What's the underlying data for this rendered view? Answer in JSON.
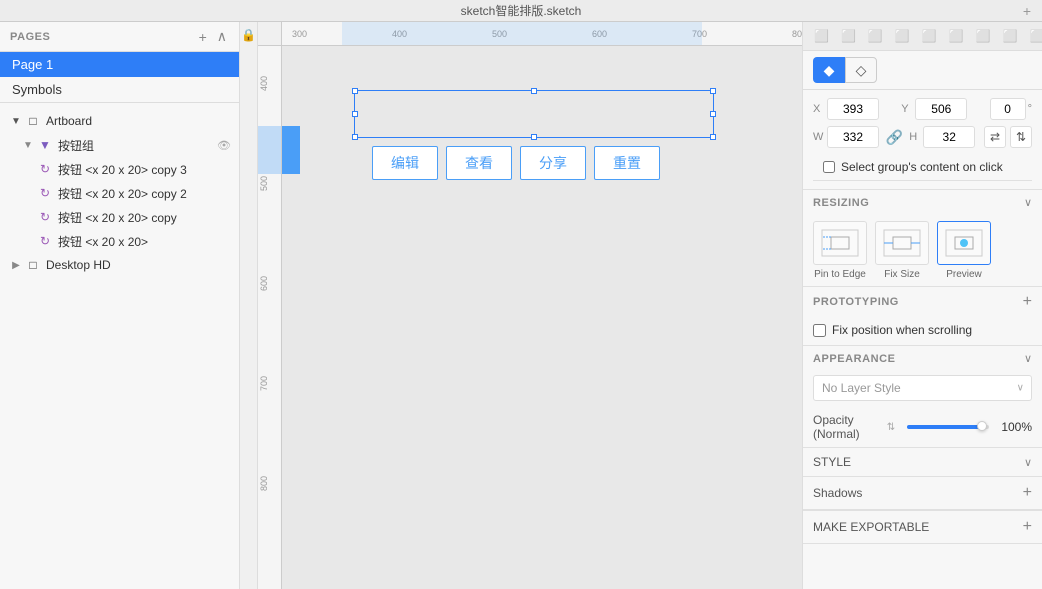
{
  "app": {
    "title": "sketch智能排版.sketch"
  },
  "left_panel": {
    "pages_title": "PAGES",
    "pages": [
      {
        "label": "Page 1",
        "active": true
      },
      {
        "label": "Symbols",
        "active": false
      }
    ],
    "layers": [
      {
        "id": "artboard",
        "label": "Artboard",
        "indent": 0,
        "type": "artboard",
        "expanded": true
      },
      {
        "id": "btn-group",
        "label": "按钮组",
        "indent": 1,
        "type": "folder",
        "expanded": true
      },
      {
        "id": "btn-copy3",
        "label": "按钮 <x 20 x 20>  copy 3",
        "indent": 2,
        "type": "component"
      },
      {
        "id": "btn-copy2",
        "label": "按钮 <x 20 x 20>  copy 2",
        "indent": 2,
        "type": "component"
      },
      {
        "id": "btn-copy",
        "label": "按钮 <x 20 x 20>  copy",
        "indent": 2,
        "type": "component"
      },
      {
        "id": "btn",
        "label": "按钮 <x 20 x 20>",
        "indent": 2,
        "type": "component"
      }
    ],
    "desktop": {
      "label": "Desktop HD",
      "type": "artboard"
    }
  },
  "canvas": {
    "buttons": [
      "编辑",
      "查看",
      "分享",
      "重置"
    ],
    "ruler": {
      "h_labels": [
        "300",
        "400",
        "500",
        "600",
        "700"
      ],
      "v_labels": [
        "400",
        "500",
        "600",
        "700",
        "800"
      ]
    }
  },
  "right_panel": {
    "style_tabs": [
      {
        "label": "fill",
        "icon": "◆",
        "active": true
      },
      {
        "label": "border",
        "icon": "◇",
        "active": false
      }
    ],
    "position": {
      "x_label": "X",
      "x_value": "393",
      "y_label": "Y",
      "y_value": "506",
      "rotation_value": "0",
      "rotation_symbol": "°"
    },
    "size": {
      "w_label": "W",
      "w_value": "332",
      "h_label": "H",
      "h_value": "32"
    },
    "checkbox_group": {
      "label": "Select group's content on click"
    },
    "resizing": {
      "title": "RESIZING",
      "options": [
        {
          "label": "Pin to Edge"
        },
        {
          "label": "Fix Size"
        },
        {
          "label": "Preview"
        }
      ]
    },
    "prototyping": {
      "title": "PROTOTYPING",
      "fix_position_label": "Fix position when scrolling"
    },
    "appearance": {
      "title": "APPEARANCE",
      "layer_style_placeholder": "No Layer Style"
    },
    "opacity": {
      "label": "Opacity (Normal)",
      "value": "100%",
      "percent": 100
    },
    "style": {
      "title": "STYLE",
      "shadows_label": "Shadows"
    },
    "make_exportable": {
      "title": "MAKE EXPORTABLE"
    }
  }
}
